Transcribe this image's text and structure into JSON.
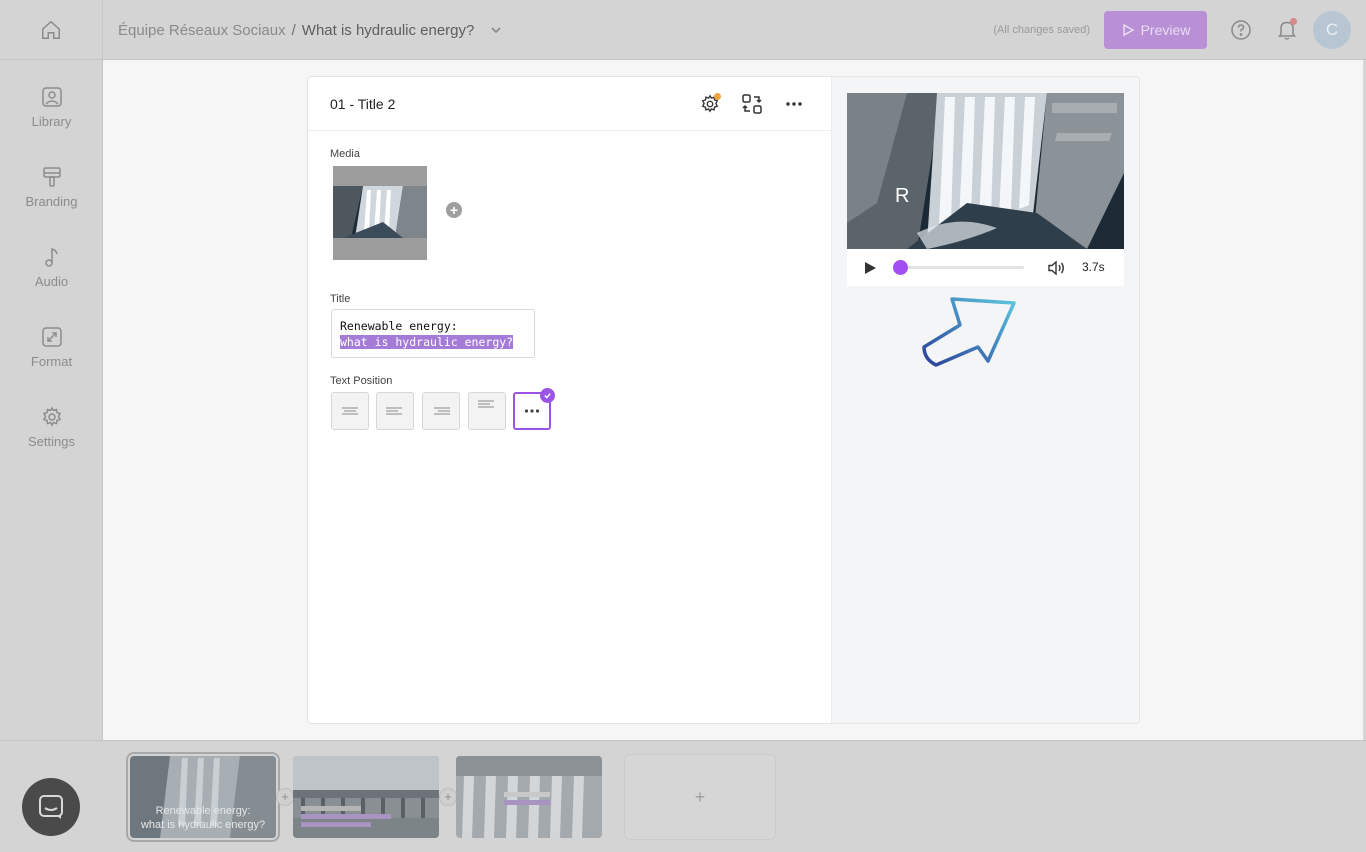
{
  "header": {
    "team": "Équipe Réseaux Sociaux",
    "separator": "/",
    "document_title": "What is hydraulic energy?",
    "save_status": "(All changes saved)",
    "preview_label": "Preview",
    "avatar_initial": "C"
  },
  "sidebar": {
    "items": [
      {
        "label": "Library",
        "icon": "image-icon"
      },
      {
        "label": "Branding",
        "icon": "paint-roller-icon"
      },
      {
        "label": "Audio",
        "icon": "music-note-icon"
      },
      {
        "label": "Format",
        "icon": "resize-icon"
      },
      {
        "label": "Settings",
        "icon": "gear-icon"
      }
    ]
  },
  "editor": {
    "slide_title": "01 - Title 2",
    "media_label": "Media",
    "title_label": "Title",
    "title_line1": "Renewable energy:",
    "title_line2": "what is hydraulic energy?",
    "text_position_label": "Text Position"
  },
  "preview": {
    "overlay_letter": "R",
    "duration": "3.7s",
    "progress": 0.0
  },
  "filmstrip": {
    "slides": [
      {
        "caption_line1": "Renewable energy:",
        "caption_line2": "what is hydraulic energy?"
      },
      {},
      {}
    ],
    "add_slide_label": "+"
  },
  "colors": {
    "accent": "#9b55e4",
    "highlight": "#a57bd8",
    "notification_dot": "#d98a8a",
    "settings_dot": "#f2a23c"
  }
}
